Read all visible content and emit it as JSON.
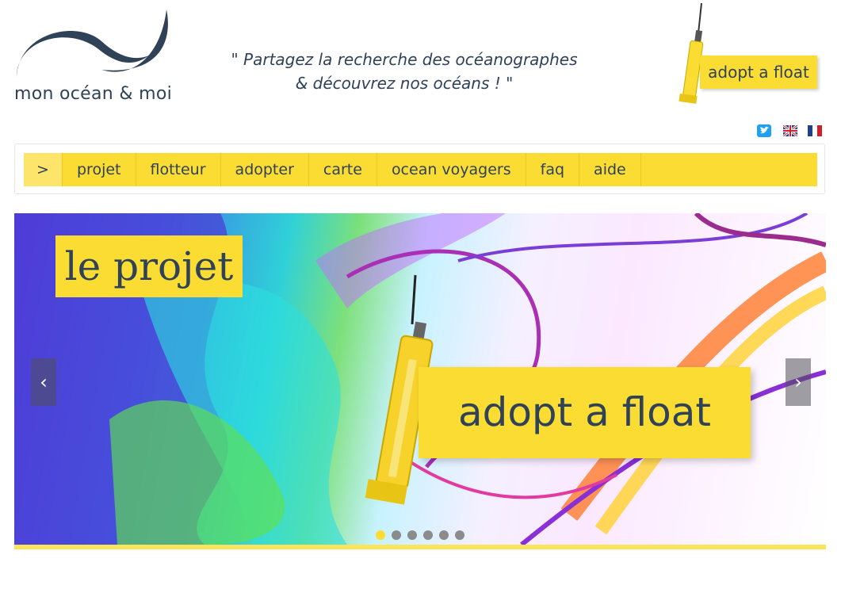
{
  "header": {
    "logo_text": "mon océan & moi",
    "tagline_line1": "\" Partagez la recherche des océanographes",
    "tagline_line2": "& découvrez nos océans ! \"",
    "cta_label": "adopt a float"
  },
  "social": {
    "twitter_icon": "twitter-icon",
    "lang_en_icon": "uk-flag-icon",
    "lang_fr_icon": "fr-flag-icon"
  },
  "nav": {
    "home_label": ">",
    "items": [
      {
        "label": "projet"
      },
      {
        "label": "flotteur"
      },
      {
        "label": "adopter"
      },
      {
        "label": "carte"
      },
      {
        "label": "ocean voyagers"
      },
      {
        "label": "faq"
      },
      {
        "label": "aide"
      }
    ]
  },
  "hero": {
    "title": "le projet",
    "cta_label": "adopt a float",
    "prev_arrow": "‹",
    "next_arrow": "›",
    "slide_count": 6,
    "active_slide": 1
  },
  "colors": {
    "brand_yellow": "#fbdc33",
    "brand_navy": "#2f4258",
    "twitter_blue": "#1da1f2"
  }
}
